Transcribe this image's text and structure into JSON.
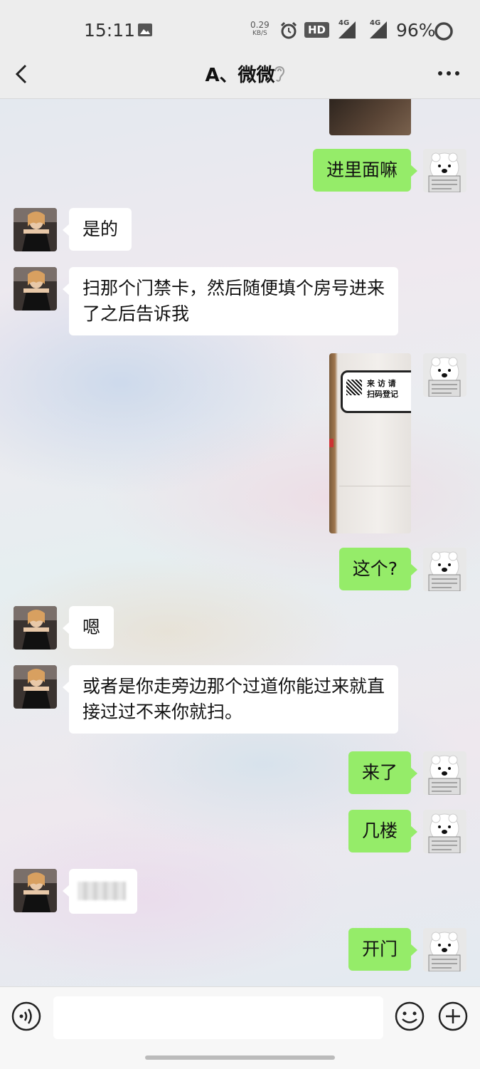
{
  "status_bar": {
    "time": "15:11",
    "net_speed_value": "0.29",
    "net_speed_unit": "KB/S",
    "hd_label": "HD",
    "signal_label": "4G",
    "battery": "96%"
  },
  "header": {
    "title": "A、微微"
  },
  "messages": [
    {
      "side": "out",
      "type": "image",
      "desc": "photo-partial"
    },
    {
      "side": "out",
      "type": "text",
      "text": "进里面嘛"
    },
    {
      "side": "in",
      "type": "text",
      "text": "是的"
    },
    {
      "side": "in",
      "type": "text",
      "text": "扫那个门禁卡，然后随便填个房号进来了之后告诉我"
    },
    {
      "side": "out",
      "type": "image",
      "desc": "qr-sign-photo",
      "sign_line1": "来 访 请",
      "sign_line2": "扫码登记"
    },
    {
      "side": "out",
      "type": "text",
      "text": "这个?"
    },
    {
      "side": "in",
      "type": "text",
      "text": "嗯"
    },
    {
      "side": "in",
      "type": "text",
      "text": "或者是你走旁边那个过道你能过来就直接过过不来你就扫。"
    },
    {
      "side": "out",
      "type": "text",
      "text": "来了"
    },
    {
      "side": "out",
      "type": "text",
      "text": "几楼"
    },
    {
      "side": "in",
      "type": "text",
      "text": ""
    },
    {
      "side": "out",
      "type": "text",
      "text": "开门"
    }
  ],
  "input": {
    "placeholder": ""
  },
  "colors": {
    "bar_bg": "#ededed",
    "out_bubble": "#95ec69",
    "in_bubble": "#ffffff"
  },
  "icons": {
    "back": "chevron-left-icon",
    "ear": "ear-icon",
    "more": "more-icon",
    "voice": "voice-icon",
    "emoji": "emoji-icon",
    "plus": "plus-icon"
  }
}
